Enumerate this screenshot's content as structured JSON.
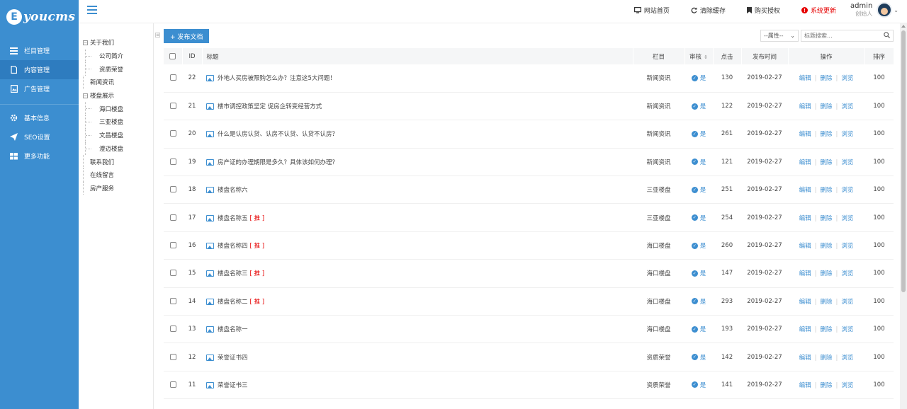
{
  "brand": {
    "logo_letter": "E",
    "logo_text": "youcms"
  },
  "sidebar": {
    "items": [
      {
        "label": "栏目管理",
        "icon": "list-icon"
      },
      {
        "label": "内容管理",
        "icon": "document-icon",
        "active": true
      },
      {
        "label": "广告管理",
        "icon": "image-icon"
      },
      {
        "label": "基本信息",
        "icon": "gear-icon"
      },
      {
        "label": "SEO设置",
        "icon": "paper-plane-icon"
      },
      {
        "label": "更多功能",
        "icon": "grid-icon"
      }
    ]
  },
  "topbar": {
    "links": [
      {
        "label": "网站首页",
        "icon": "monitor-icon"
      },
      {
        "label": "清除缓存",
        "icon": "refresh-icon"
      },
      {
        "label": "购买授权",
        "icon": "bookmark-icon"
      },
      {
        "label": "系统更新",
        "icon": "alert-icon"
      }
    ],
    "user": {
      "name": "admin",
      "role": "创始人"
    }
  },
  "tree": {
    "nodes": [
      {
        "label": "关于我们",
        "level": 0,
        "toggle": "−"
      },
      {
        "label": "公司简介",
        "level": 1
      },
      {
        "label": "资质荣誉",
        "level": 1
      },
      {
        "label": "新闻资讯",
        "level": 0
      },
      {
        "label": "楼盘展示",
        "level": 0,
        "toggle": "−"
      },
      {
        "label": "海口楼盘",
        "level": 1
      },
      {
        "label": "三亚楼盘",
        "level": 1
      },
      {
        "label": "文昌楼盘",
        "level": 1
      },
      {
        "label": "澄迈楼盘",
        "level": 1
      },
      {
        "label": "联系我们",
        "level": 0
      },
      {
        "label": "在线留言",
        "level": 0
      },
      {
        "label": "房产服务",
        "level": 0
      }
    ]
  },
  "toolbar": {
    "publish_label": "+ 发布文档",
    "attr_select": "--属性--",
    "search_placeholder": "标题搜索..."
  },
  "table": {
    "headers": {
      "id": "ID",
      "title": "标题",
      "column": "栏目",
      "audit": "审核",
      "clicks": "点击",
      "date": "发布时间",
      "ops": "操作",
      "sort": "排序"
    },
    "op_labels": {
      "edit": "编辑",
      "delete": "删除",
      "view": "浏览"
    },
    "audit_label": "是",
    "rec_label": "[ 推 ]",
    "rows": [
      {
        "id": "22",
        "title": "外地人买房被限购怎么办？注意这5大问题！",
        "rec": false,
        "column": "新闻资讯",
        "clicks": "130",
        "date": "2019-02-27",
        "sort": "100"
      },
      {
        "id": "21",
        "title": "楼市调控政策坚定 促房企转变经营方式",
        "rec": false,
        "column": "新闻资讯",
        "clicks": "122",
        "date": "2019-02-27",
        "sort": "100"
      },
      {
        "id": "20",
        "title": "什么是认房认贷、认房不认贷、认贷不认房？",
        "rec": false,
        "column": "新闻资讯",
        "clicks": "261",
        "date": "2019-02-27",
        "sort": "100"
      },
      {
        "id": "19",
        "title": "房产证的办理期限是多久？具体该如何办理？",
        "rec": false,
        "column": "新闻资讯",
        "clicks": "121",
        "date": "2019-02-27",
        "sort": "100"
      },
      {
        "id": "18",
        "title": "楼盘名称六",
        "rec": false,
        "column": "三亚楼盘",
        "clicks": "251",
        "date": "2019-02-27",
        "sort": "100"
      },
      {
        "id": "17",
        "title": "楼盘名称五",
        "rec": true,
        "column": "三亚楼盘",
        "clicks": "254",
        "date": "2019-02-27",
        "sort": "100"
      },
      {
        "id": "16",
        "title": "楼盘名称四",
        "rec": true,
        "column": "海口楼盘",
        "clicks": "260",
        "date": "2019-02-27",
        "sort": "100"
      },
      {
        "id": "15",
        "title": "楼盘名称三",
        "rec": true,
        "column": "海口楼盘",
        "clicks": "147",
        "date": "2019-02-27",
        "sort": "100"
      },
      {
        "id": "14",
        "title": "楼盘名称二",
        "rec": true,
        "column": "海口楼盘",
        "clicks": "293",
        "date": "2019-02-27",
        "sort": "100"
      },
      {
        "id": "13",
        "title": "楼盘名称一",
        "rec": false,
        "column": "海口楼盘",
        "clicks": "193",
        "date": "2019-02-27",
        "sort": "100"
      },
      {
        "id": "12",
        "title": "荣誉证书四",
        "rec": false,
        "column": "资质荣誉",
        "clicks": "142",
        "date": "2019-02-27",
        "sort": "100"
      },
      {
        "id": "11",
        "title": "荣誉证书三",
        "rec": false,
        "column": "资质荣誉",
        "clicks": "141",
        "date": "2019-02-27",
        "sort": "100"
      }
    ]
  },
  "colors": {
    "primary": "#3c8ed0",
    "sidebar_active": "#2e7cbf",
    "alert": "#e60000"
  }
}
